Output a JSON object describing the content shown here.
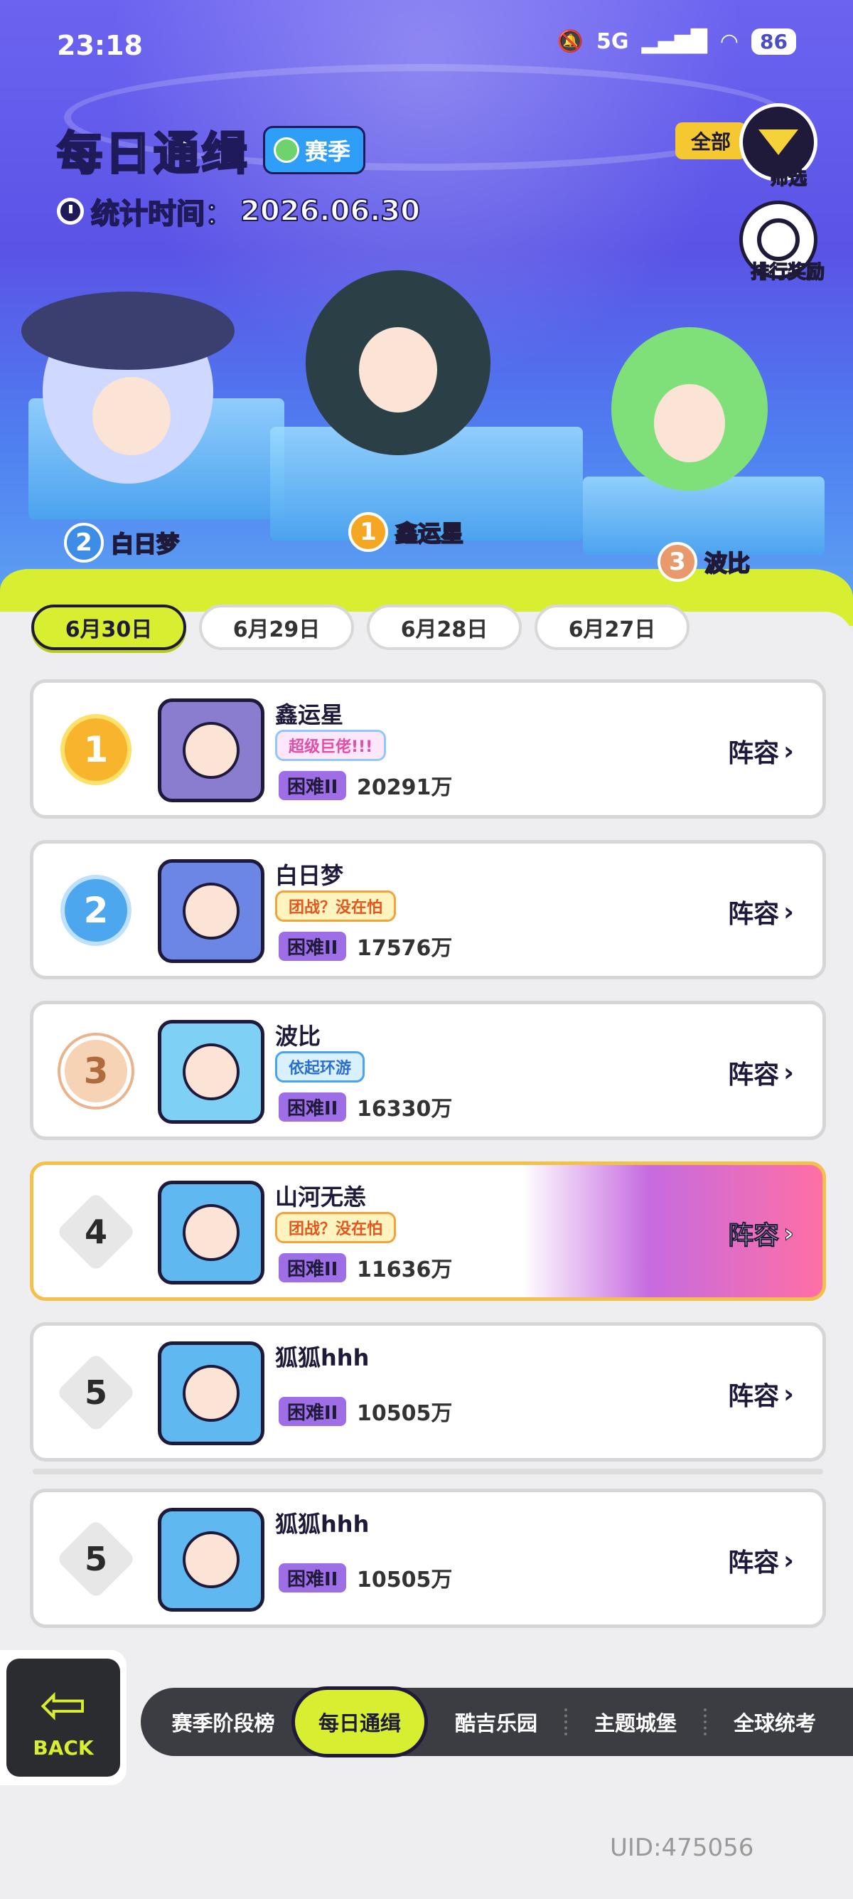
{
  "status_bar": {
    "time": "23:18",
    "network": "5G",
    "battery": "86"
  },
  "header": {
    "title": "每日通缉",
    "season_tag": "赛季",
    "stat_label": "统计时间：",
    "stat_date": "2026.06.30",
    "filter_all": "全部",
    "filter_label": "筛选",
    "reward_label": "排行奖励"
  },
  "podium": [
    {
      "rank": "2",
      "name": "白日梦"
    },
    {
      "rank": "1",
      "name": "鑫运星"
    },
    {
      "rank": "3",
      "name": "波比"
    }
  ],
  "date_tabs": [
    "6月30日",
    "6月29日",
    "6月28日",
    "6月27日"
  ],
  "ranking": [
    {
      "rank": "1",
      "name": "鑫运星",
      "title": "超级巨佬!!!",
      "difficulty": "困难II",
      "score": "20291万",
      "action": "阵容"
    },
    {
      "rank": "2",
      "name": "白日梦",
      "title": "团战？没在怕",
      "difficulty": "困难II",
      "score": "17576万",
      "action": "阵容"
    },
    {
      "rank": "3",
      "name": "波比",
      "title": "依起环游",
      "difficulty": "困难II",
      "score": "16330万",
      "action": "阵容"
    },
    {
      "rank": "4",
      "name": "山河无恙",
      "title": "团战？没在怕",
      "difficulty": "困难II",
      "score": "11636万",
      "action": "阵容"
    },
    {
      "rank": "5",
      "name": "狐狐hhh",
      "difficulty": "困难II",
      "score": "10505万",
      "action": "阵容"
    },
    {
      "rank": "5",
      "name": "狐狐hhh",
      "difficulty": "困难II",
      "score": "10505万",
      "action": "阵容"
    }
  ],
  "bottom_nav": {
    "back_label": "BACK",
    "tabs": [
      "赛季阶段榜",
      "每日通缉",
      "酷吉乐园",
      "主题城堡",
      "全球统考"
    ],
    "active": "每日通缉"
  },
  "uid": "UID:475056",
  "colors": {
    "accent": "#d7ef30",
    "header_bg": "#5a53e6",
    "dark": "#1f1a3a",
    "difficulty": "#9d6ee5",
    "highlight_border": "#f4c04c"
  }
}
